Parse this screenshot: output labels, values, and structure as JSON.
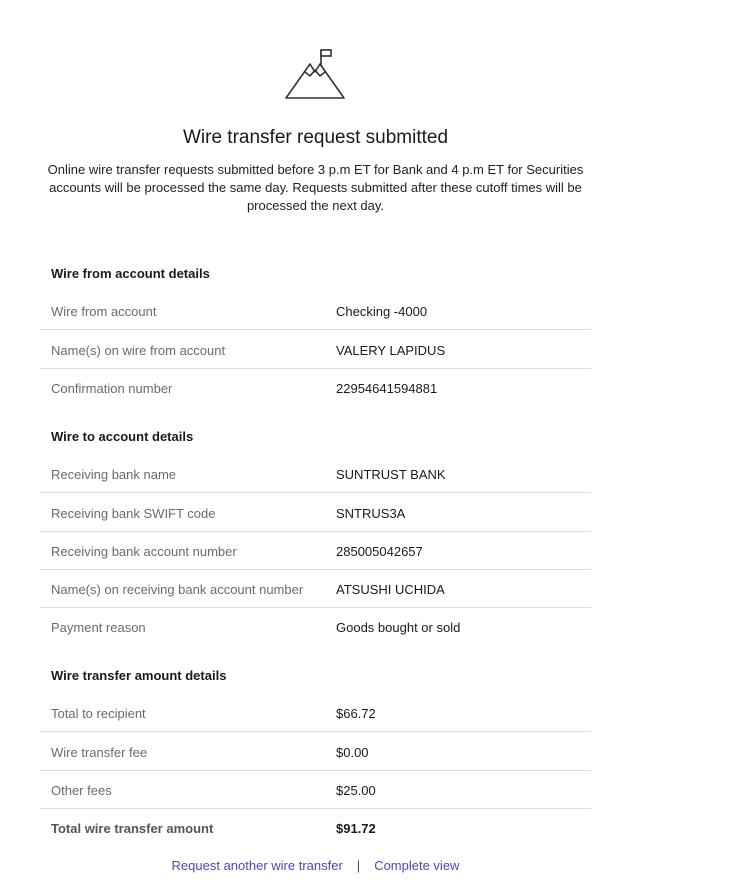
{
  "hero": {
    "icon": "mountain-flag-icon",
    "title": "Wire transfer request submitted",
    "description": "Online wire transfer requests submitted before 3 p.m ET for Bank and 4 p.m ET for Securities accounts will be processed the same day. Requests submitted after these cutoff times will be processed the next day."
  },
  "sections": {
    "from": {
      "heading": "Wire from account details",
      "rows": [
        {
          "label": "Wire from account",
          "value": "Checking -4000"
        },
        {
          "label": "Name(s) on wire from account",
          "value": "VALERY LAPIDUS"
        },
        {
          "label": "Confirmation number",
          "value": "22954641594881"
        }
      ]
    },
    "to": {
      "heading": "Wire to account details",
      "rows": [
        {
          "label": "Receiving bank name",
          "value": "SUNTRUST BANK"
        },
        {
          "label": "Receiving bank SWIFT code",
          "value": "SNTRUS3A"
        },
        {
          "label": "Receiving bank account number",
          "value": "285005042657"
        },
        {
          "label": "Name(s) on receiving bank account number",
          "value": "ATSUSHI UCHIDA"
        },
        {
          "label": "Payment reason",
          "value": "Goods bought or sold"
        }
      ]
    },
    "amount": {
      "heading": "Wire transfer amount details",
      "rows": [
        {
          "label": "Total to recipient",
          "value": "$66.72"
        },
        {
          "label": "Wire transfer fee",
          "value": "$0.00"
        },
        {
          "label": "Other fees",
          "value": "$25.00"
        },
        {
          "label": "Total wire transfer amount",
          "value": "$91.72"
        }
      ]
    }
  },
  "footer": {
    "request_another": "Request another wire transfer",
    "separator": "|",
    "complete_view": "Complete view",
    "link_color": "#5a3fbf"
  }
}
